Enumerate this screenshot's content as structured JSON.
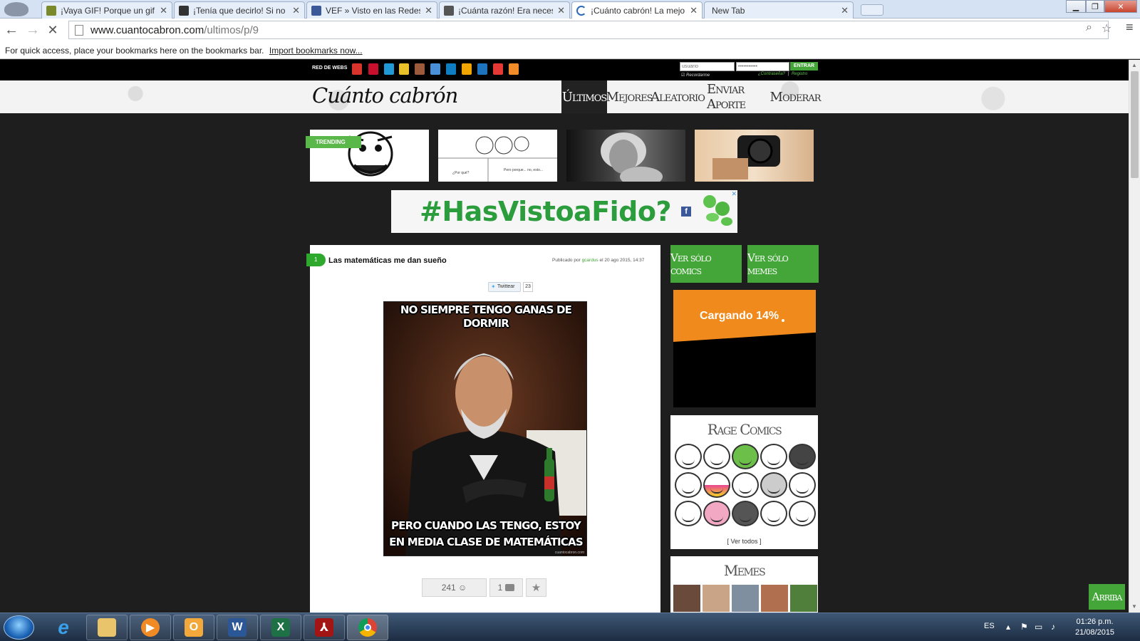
{
  "browser": {
    "tabs": [
      {
        "title": "¡Vaya GIF! Porque un gif v",
        "favicon_color": "#7a8a2a"
      },
      {
        "title": "¡Tenía que decirlo! Si no n",
        "favicon_color": "#333333"
      },
      {
        "title": "VEF » Visto en las Redes »",
        "favicon_color": "#3b5998"
      },
      {
        "title": "¡Cuánta razón! Era necesa",
        "favicon_color": "#555555"
      },
      {
        "title": "¡Cuánto cabrón! La mejor",
        "favicon_color": "#2a6ab8"
      },
      {
        "title": "New Tab",
        "favicon_color": "#ffffff"
      }
    ],
    "url_host": "www.cuantocabron.com",
    "url_path": "/ultimos/p/9",
    "bookmarks_prompt": "For quick access, place your bookmarks here on the bookmarks bar.",
    "import_link": "Import bookmarks now..."
  },
  "topbar": {
    "network_label": "RED DE WEBS",
    "network_icon_colors": [
      "#d9342b",
      "#c8102e",
      "#1f9ad6",
      "#e8c12a",
      "#9b5a3c",
      "#4a90d9",
      "#0f7dc2",
      "#f0a500",
      "#1e73be",
      "#e53935",
      "#f28c28"
    ],
    "user_placeholder": "usuario",
    "pass_placeholder": "•••••••••••",
    "login_button": "ENTRAR",
    "remember": "Recordarme",
    "forgot": "¿Contraseña?",
    "register": "Registro",
    "separator": "|"
  },
  "header": {
    "logo": "Cuánto cabrón",
    "nav": [
      "Últimos",
      "Mejores",
      "Aleatorio",
      "Enviar Aporte",
      "Moderar"
    ]
  },
  "trending": {
    "label": "TRENDING",
    "captions_thumb2": [
      "¿Por qué?",
      "Pero porque... no, esto..."
    ]
  },
  "ad": {
    "text": "#HasVistoaFido?",
    "close": "✕"
  },
  "post": {
    "rank": "1",
    "title": "Las matemáticas me dan sueño",
    "meta_prefix": "Publicado por",
    "author": "gcardus",
    "meta_suffix": "el 20 ago 2015, 14:37",
    "tweet_label": "Twittear",
    "tweet_count": "23",
    "meme_top": "NO SIEMPRE TENGO GANAS DE DORMIR",
    "meme_bottom_1": "PERO CUANDO LAS TENGO, ESTOY",
    "meme_bottom_2": "EN MEDIA CLASE DE MATEMÁTICAS",
    "meme_credit": "cuantocabron.com",
    "votes": "241 ☺",
    "comments": "1",
    "star": "★"
  },
  "sidebar": {
    "btn_comics": "Ver sólo comics",
    "btn_memes": "Ver sólo memes",
    "loading": "Cargando 14%",
    "rage_title": "Rage Comics",
    "see_all": "[ Ver todos ]",
    "memes_title": "Memes",
    "meme_thumb_colors": [
      "#6a4a3a",
      "#c9a486",
      "#7f8fa0",
      "#b07050",
      "#4f7f3a"
    ]
  },
  "scroll_top": "Arriba",
  "taskbar": {
    "lang": "ES",
    "time": "01:26 p.m.",
    "date": "21/08/2015"
  }
}
